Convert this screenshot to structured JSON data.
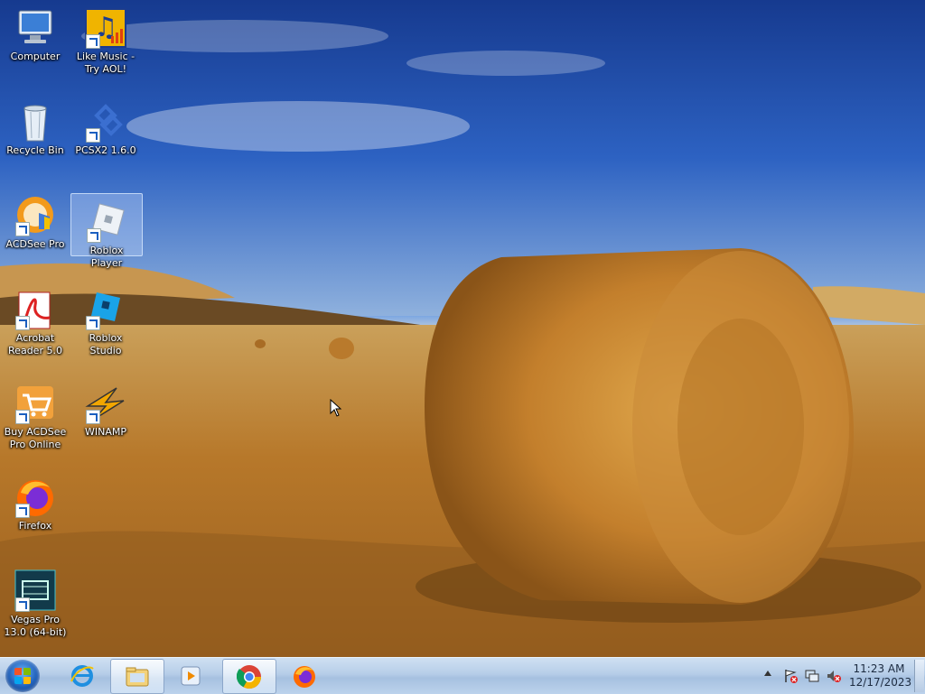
{
  "desktop": {
    "icons": [
      {
        "label": "Computer",
        "icon": "computer-icon"
      },
      {
        "label": "Like Music - Try AOL!",
        "icon": "music-note-icon"
      },
      {
        "label": "Recycle Bin",
        "icon": "recycle-bin-icon"
      },
      {
        "label": "PCSX2 1.6.0",
        "icon": "pcsx2-icon"
      },
      {
        "label": "ACDSee Pro",
        "icon": "acdsee-icon"
      },
      {
        "label": "Roblox Player",
        "icon": "roblox-player-icon",
        "selected": true
      },
      {
        "label": "Acrobat Reader 5.0",
        "icon": "acrobat-icon"
      },
      {
        "label": "Roblox Studio",
        "icon": "roblox-studio-icon"
      },
      {
        "label": "Buy ACDSee Pro Online",
        "icon": "shopping-cart-icon"
      },
      {
        "label": "WINAMP",
        "icon": "winamp-icon"
      },
      {
        "label": "Firefox",
        "icon": "firefox-icon"
      },
      {
        "label": "Vegas Pro 13.0 (64-bit)",
        "icon": "vegas-pro-icon"
      }
    ]
  },
  "taskbar": {
    "start": "start-orb-icon",
    "pinned": [
      {
        "icon": "internet-explorer-icon"
      },
      {
        "icon": "file-explorer-icon"
      },
      {
        "icon": "media-player-icon"
      },
      {
        "icon": "chrome-icon"
      },
      {
        "icon": "firefox-icon"
      }
    ],
    "tray": {
      "icons": [
        "show-hidden-icons-chevron",
        "action-center-flag-icon",
        "network-icon",
        "volume-muted-icon"
      ],
      "time": "11:23 AM",
      "date": "12/17/2023"
    }
  },
  "colors": {
    "sky": "#1b3f9a",
    "field": "#b8772a",
    "taskbar": "#b6cde8"
  }
}
